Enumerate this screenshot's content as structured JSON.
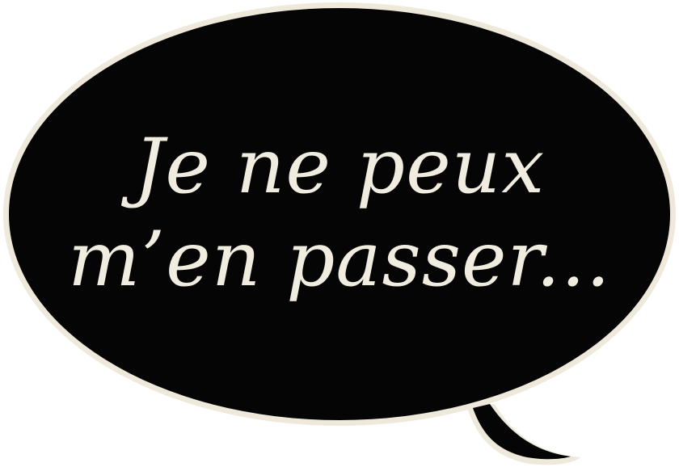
{
  "speech_bubble": {
    "lines": [
      "Je ne peux",
      "m’en passer..."
    ],
    "colors": {
      "fill": "#050505",
      "outline": "#efe9dc",
      "text": "#f1ece0",
      "background": "#ffffff"
    }
  }
}
